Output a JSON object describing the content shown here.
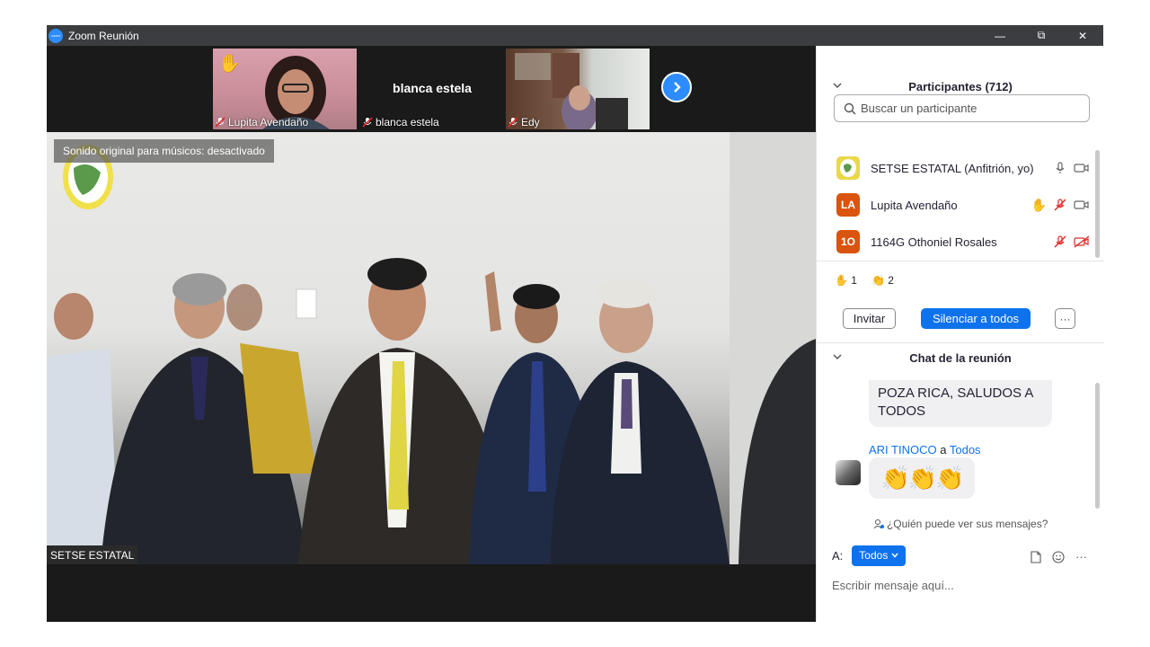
{
  "window": {
    "title": "Zoom Reunión",
    "logo_text": "zoom",
    "controls": {
      "minimize": "—",
      "restore": "⧉",
      "close": "✕"
    }
  },
  "thumbnails": [
    {
      "name": "Lupita Avendaño",
      "hand_raised": true
    },
    {
      "name": "blanca estela",
      "display_text": "blanca estela"
    },
    {
      "name": "Edy"
    }
  ],
  "main_video": {
    "banner": "Sonido original para músicos: desactivado",
    "name_tag": "SETSE ESTATAL"
  },
  "participants": {
    "header": "Participantes (712)",
    "search_placeholder": "Buscar un participante",
    "list": [
      {
        "name": "SETSE ESTATAL (Anfitrión, yo)",
        "avatar": "logo",
        "color": "#e9d94a"
      },
      {
        "name": "Lupita Avendaño",
        "avatar": "LA",
        "color": "#d9540e",
        "hand": "✋"
      },
      {
        "name": "1164G Othoniel Rosales",
        "avatar": "1O",
        "color": "#d9540e"
      }
    ],
    "reactions": [
      {
        "icon": "✋",
        "count": "1"
      },
      {
        "icon": "👏",
        "count": "2"
      }
    ],
    "invite_label": "Invitar",
    "mute_all_label": "Silenciar a todos",
    "more_label": "···"
  },
  "chat": {
    "header": "Chat de la reunión",
    "messages": [
      {
        "text": "POZA RICA, SALUDOS A TODOS"
      },
      {
        "sender": "ARI TINOCO",
        "connector": "a",
        "recipient": "Todos",
        "text": "👏👏👏"
      }
    ],
    "who_sees": "¿Quién puede ver sus mensajes?",
    "to_label": "A:",
    "to_value": "Todos",
    "input_placeholder": "Escribir mensaje aquí..."
  }
}
